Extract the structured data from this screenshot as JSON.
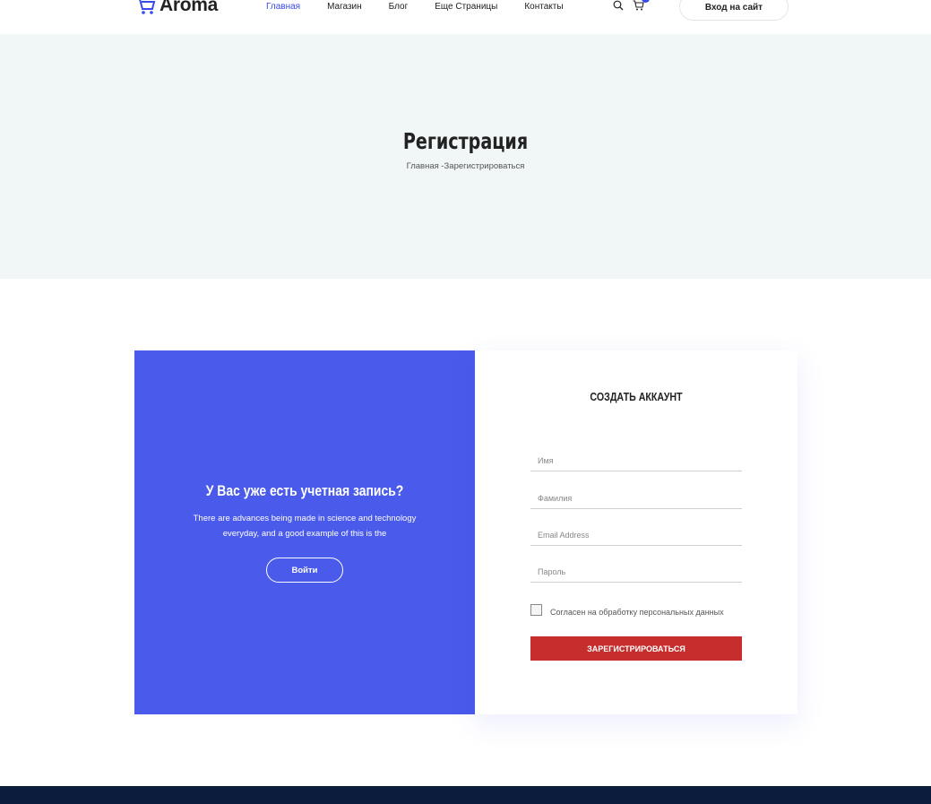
{
  "header": {
    "logo_text": "Aroma",
    "nav": [
      "Главная",
      "Магазин",
      "Блог",
      "Еще Страницы",
      "Контакты"
    ],
    "active_index": 0,
    "login_label": "Вход на сайт"
  },
  "banner": {
    "title": "Регистрация",
    "breadcrumb": "Главная -Зарегистрироваться"
  },
  "login_panel": {
    "title": "У Вас уже есть учетная запись?",
    "text": "There are advances being made in science and technology everyday, and a good example of this is the",
    "button": "Войти"
  },
  "register_form": {
    "title": "СОЗДАТЬ АККАУНТ",
    "first_name_placeholder": "Имя",
    "last_name_placeholder": "Фамилия",
    "email_placeholder": "Email Address",
    "password_placeholder": "Пароль",
    "consent_label": "Согласен на обработку персональных данных",
    "submit_label": "ЗАРЕГИСТРИРОВАТЬСЯ"
  },
  "colors": {
    "accent": "#384aeb",
    "panel_blue": "#4a5aeb",
    "submit_red": "#c62d2d",
    "footer": "#0b1c3d"
  }
}
